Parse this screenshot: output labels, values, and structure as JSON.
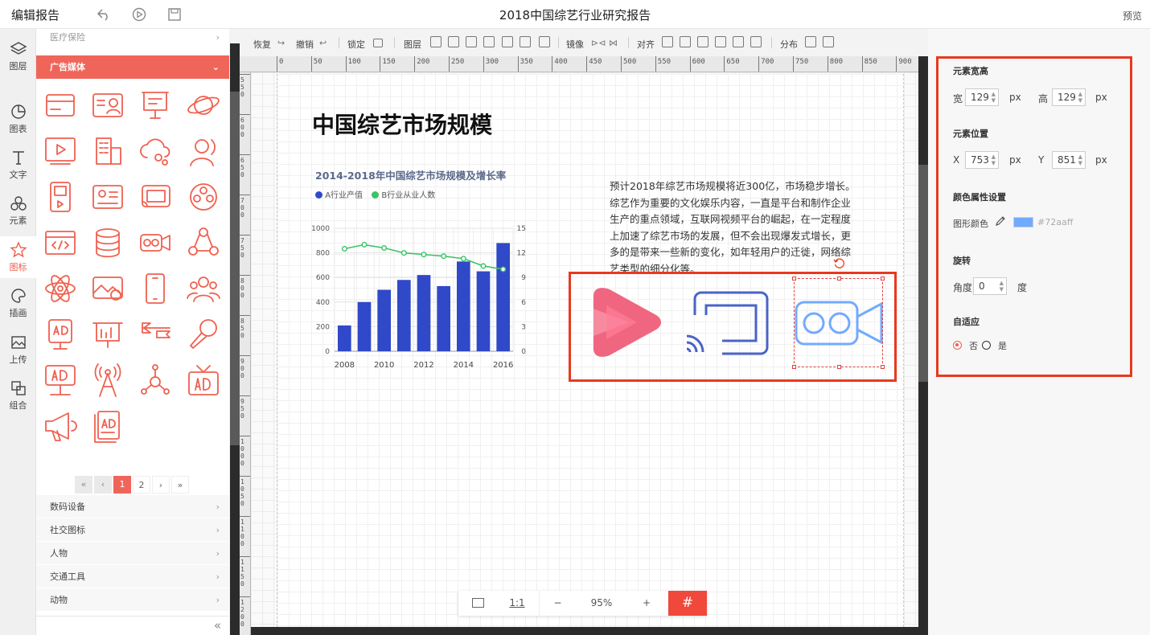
{
  "topbar": {
    "app_title": "编辑报告",
    "doc_title": "2018中国综艺行业研究报告",
    "preview": "预览"
  },
  "leftnav": [
    {
      "label": "图层",
      "icon": "layers-icon"
    },
    {
      "label": "图表",
      "icon": "pie-chart-icon"
    },
    {
      "label": "文字",
      "icon": "text-icon"
    },
    {
      "label": "元素",
      "icon": "shapes-icon"
    },
    {
      "label": "图标",
      "icon": "star-icon",
      "active": true
    },
    {
      "label": "插画",
      "icon": "palette-icon"
    },
    {
      "label": "上传",
      "icon": "upload-image-icon"
    },
    {
      "label": "组合",
      "icon": "group-icon"
    }
  ],
  "panel": {
    "prev_category": "医疗保险",
    "active_category": "广告媒体",
    "icons": [
      "credit-card",
      "id-card",
      "presentation-board",
      "planet",
      "video-player",
      "office-building",
      "cloud-network",
      "user-headset",
      "mp3-player",
      "id-card-list",
      "cast-screen",
      "film-reel",
      "code-window",
      "database",
      "video-camera",
      "share-network",
      "atom",
      "image-copyright",
      "mobile-phone",
      "user-group",
      "ad-billboard",
      "presentation-chart",
      "arrow-sign",
      "microphone",
      "ad-stand",
      "radio-tower",
      "molecule",
      "ad-tv",
      "megaphone",
      "ad-document"
    ],
    "pagination": {
      "pages": [
        "1",
        "2"
      ],
      "current": "1"
    },
    "categories": [
      "数码设备",
      "社交图标",
      "人物",
      "交通工具",
      "动物"
    ]
  },
  "toolbar": {
    "redo": "恢复",
    "undo": "撤销",
    "lock": "锁定",
    "layer": "图层",
    "mirror": "镜像",
    "align": "对齐",
    "distribute": "分布"
  },
  "ruler": {
    "h_ticks": [
      "0",
      "50",
      "100",
      "150",
      "200",
      "250",
      "300",
      "350",
      "400",
      "450",
      "500",
      "550",
      "600",
      "650",
      "700",
      "750",
      "800",
      "850",
      "900"
    ],
    "v_ticks": [
      "550",
      "600",
      "650",
      "700",
      "750",
      "800",
      "850",
      "900",
      "950",
      "1000",
      "1050",
      "1100",
      "1150",
      "1200"
    ]
  },
  "page": {
    "title": "中国综艺市场规模",
    "paragraph": "预计2018年综艺市场规模将近300亿，市场稳步增长。综艺作为重要的文化娱乐内容，一直是平台和制作企业生产的重点领域，互联网视频平台的崛起，在一定程度上加速了综艺市场的发展，但不会出现爆发式增长，更多的是带来一些新的变化，如年轻用户的迁徙，网络综艺类型的细分化等。"
  },
  "chart_data": {
    "type": "bar",
    "title": "2014-2018年中国综艺市场规模及增长率",
    "x": [
      2008,
      2009,
      2010,
      2011,
      2012,
      2013,
      2014,
      2015,
      2016
    ],
    "x_tick_labels": [
      "2008",
      "2010",
      "2012",
      "2014",
      "2016"
    ],
    "series": [
      {
        "name": "A行业产值",
        "type": "bar",
        "axis": "left",
        "color": "#3049c8",
        "values": [
          210,
          400,
          500,
          580,
          620,
          530,
          730,
          650,
          880
        ]
      },
      {
        "name": "B行业从业人数",
        "type": "line",
        "axis": "right",
        "color": "#3ac46a",
        "values": [
          12.5,
          13,
          12.6,
          12,
          11.8,
          11.6,
          11.3,
          10.4,
          10
        ]
      }
    ],
    "ylim_left": [
      0,
      1000
    ],
    "yticks_left": [
      "0",
      "200",
      "400",
      "600",
      "800",
      "1000"
    ],
    "ylim_right": [
      0,
      15
    ],
    "yticks_right": [
      "0",
      "3",
      "6",
      "9",
      "12",
      "15"
    ],
    "grid": true,
    "legend": "top-left"
  },
  "selection": {
    "icons": [
      "play-logo-icon",
      "cast-screen-icon",
      "video-camera-icon"
    ],
    "colors": {
      "play": "#f06680",
      "cast": "#4a63c8",
      "camera": "#72aaff"
    }
  },
  "zoom": {
    "fit": "",
    "one_to_one": "1:1",
    "minus": "−",
    "value": "95%",
    "plus": "+"
  },
  "props": {
    "size_title": "元素宽高",
    "width_label": "宽",
    "width": "129",
    "height_label": "高",
    "height": "129",
    "unit": "px",
    "pos_title": "元素位置",
    "x_label": "X",
    "x": "753",
    "y_label": "Y",
    "y": "851",
    "color_title": "颜色属性设置",
    "shape_color_label": "图形颜色",
    "color_value": "#72aaff",
    "rotate_title": "旋转",
    "angle_label": "角度",
    "angle": "0",
    "angle_unit": "度",
    "adaptive_title": "自适应",
    "no": "否",
    "yes": "是"
  }
}
